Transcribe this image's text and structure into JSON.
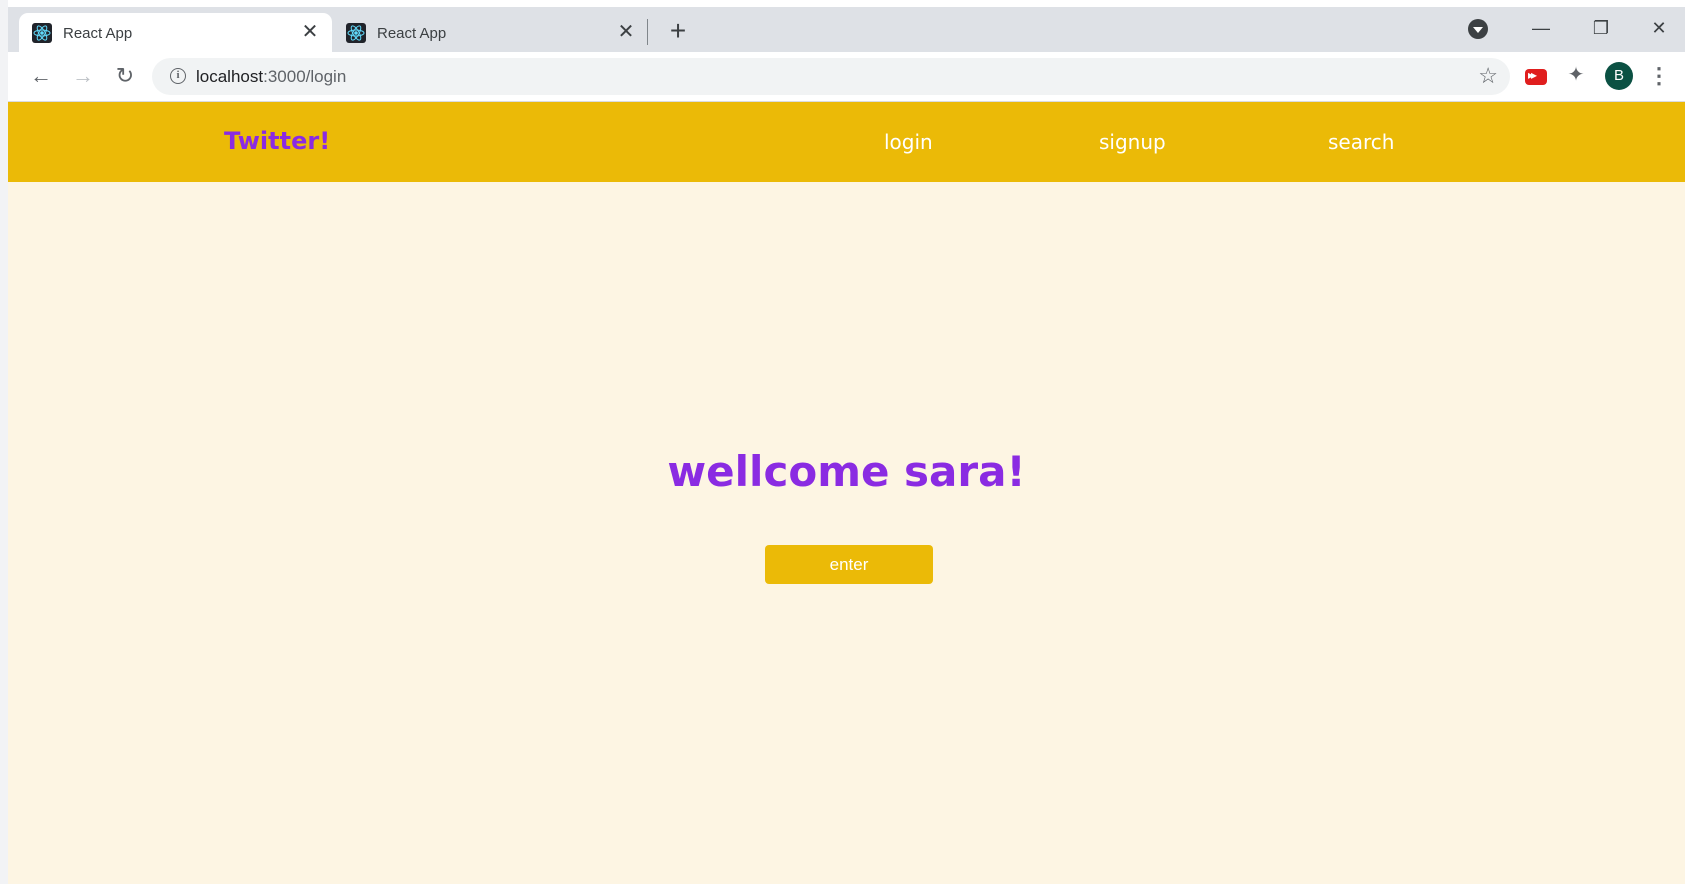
{
  "browser": {
    "tabs": [
      {
        "title": "React App",
        "active": true
      },
      {
        "title": "React App",
        "active": false
      }
    ],
    "close_glyph": "✕",
    "new_tab_glyph": "+",
    "window_controls": {
      "minimize": "—",
      "restore": "❐",
      "close": "✕"
    },
    "nav": {
      "back": "←",
      "forward": "→",
      "reload": "↻"
    },
    "url": {
      "host": "localhost",
      "path": ":3000/login"
    },
    "info_glyph": "i",
    "star_glyph": "☆",
    "extensions_glyph": "✦",
    "profile_initial": "B",
    "menu_glyph": "⋮"
  },
  "app": {
    "brand": "Twitter!",
    "nav_links": [
      "login",
      "signup",
      "search"
    ],
    "welcome": "wellcome sara!",
    "enter_label": "enter"
  },
  "colors": {
    "nav_bg": "#ebba07",
    "brand_purple": "#8a2be2",
    "page_bg": "#fdf5e3",
    "avatar_bg": "#0b5143"
  },
  "icons": [
    "react-logo-icon",
    "close-icon",
    "plus-icon",
    "tab-search-icon",
    "back-arrow-icon",
    "forward-arrow-icon",
    "reload-icon",
    "info-icon",
    "star-icon",
    "youtube-extension-icon",
    "puzzle-icon",
    "kebab-menu-icon"
  ]
}
